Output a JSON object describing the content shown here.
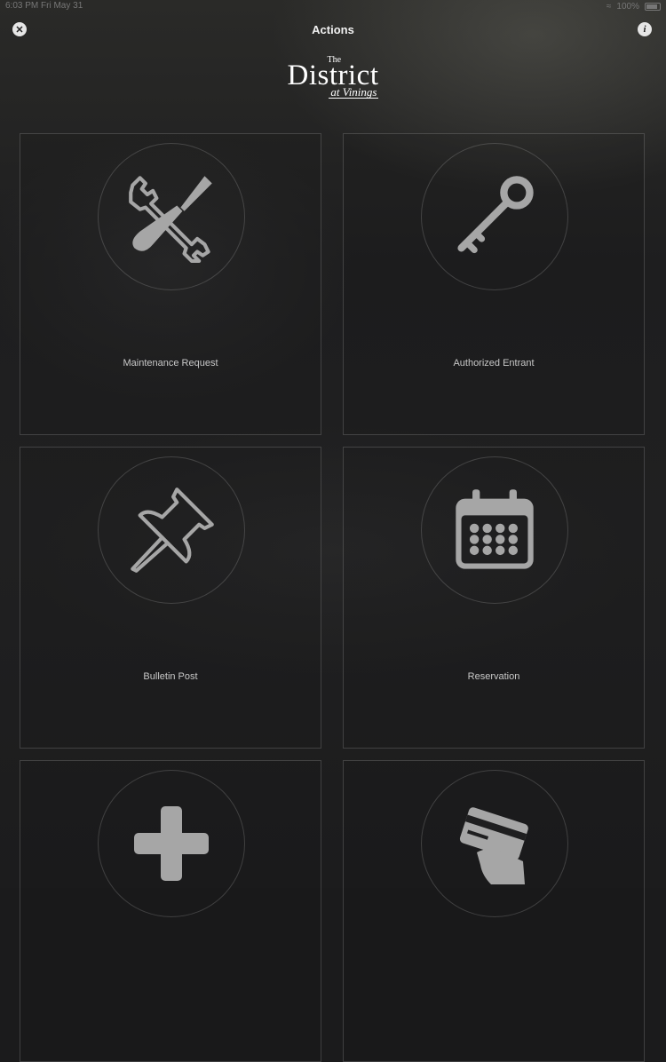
{
  "status_bar": {
    "time": "6:03 PM",
    "date": "Fri May 31",
    "battery": "100%"
  },
  "nav": {
    "title": "Actions"
  },
  "logo": {
    "the": "The",
    "main": "District",
    "sub": "at Vinings"
  },
  "tiles": [
    {
      "label": "Maintenance Request",
      "icon": "wrench-screwdriver-icon"
    },
    {
      "label": "Authorized Entrant",
      "icon": "key-icon"
    },
    {
      "label": "Bulletin Post",
      "icon": "pushpin-icon"
    },
    {
      "label": "Reservation",
      "icon": "calendar-icon"
    },
    {
      "label": "",
      "icon": "plus-icon"
    },
    {
      "label": "",
      "icon": "payment-card-icon"
    }
  ],
  "colors": {
    "icon": "#a6a6a6",
    "background": "#1b1b1c",
    "tile_border": "#4a4a4a"
  }
}
